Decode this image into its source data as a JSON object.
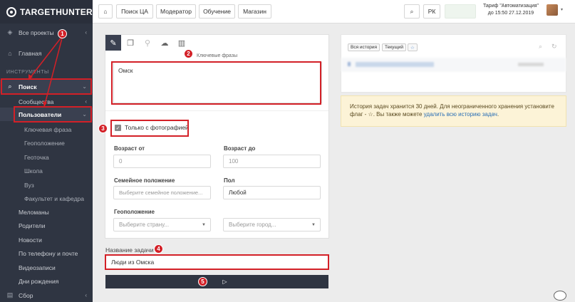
{
  "app": {
    "logo_text": "TARGETHUNTER"
  },
  "sidebar": {
    "all_projects": "Все проекты",
    "main": "Главная",
    "section_tools": "ИНСТРУМЕНТЫ",
    "search": "Поиск",
    "communities": "Сообщества",
    "users": "Пользователи",
    "sub_items": [
      "Ключевая фраза",
      "Геоположение",
      "Геоточка",
      "Школа",
      "Вуз",
      "Факультет и кафедра"
    ],
    "items_after": [
      "Меломаны",
      "Родители",
      "Новости",
      "По телефону и почте",
      "Видеозаписи",
      "Дни рождения"
    ],
    "collection": "Сбор"
  },
  "topbar": {
    "home_icon": "home-icon",
    "search_ca": "Поиск ЦА",
    "moderator": "Модератор",
    "learning": "Обучение",
    "shop": "Магазин",
    "rk": "РК",
    "plan_line1": "Тариф \"Автоматизация\"",
    "plan_line2": "до 15:50 27.12.2019"
  },
  "form": {
    "tabs": [
      "edit-icon",
      "copy-icon",
      "pin-icon",
      "upload-icon",
      "book-icon"
    ],
    "keywords_label": "Ключевые фразы",
    "keywords_value": "Омск",
    "only_photo_label": "Только с фотографией",
    "age_from_label": "Возраст от",
    "age_from_placeholder": "0",
    "age_to_label": "Возраст до",
    "age_to_placeholder": "100",
    "family_label": "Семейное положение",
    "family_placeholder": "Выберите семейное положение...",
    "sex_label": "Пол",
    "sex_value": "Любой",
    "geo_label": "Геоположение",
    "country_placeholder": "Выберите страну...",
    "city_placeholder": "Выберите город...",
    "task_name_label": "Название задачи",
    "task_name_value": "Люди из Омска"
  },
  "history": {
    "all_history": "Вся история",
    "current": "Текущий",
    "notice_text": "История задач хранится 30 дней. Для неограниченного хранения установите флаг - ☆. Вы также можете ",
    "notice_link": "удалить всю историю задач",
    "notice_end": "."
  },
  "steps": [
    "1",
    "2",
    "3",
    "4",
    "5"
  ],
  "colors": {
    "accent_red": "#d32027",
    "sidebar_bg": "#2f3542",
    "run_bar": "#2f3542"
  }
}
